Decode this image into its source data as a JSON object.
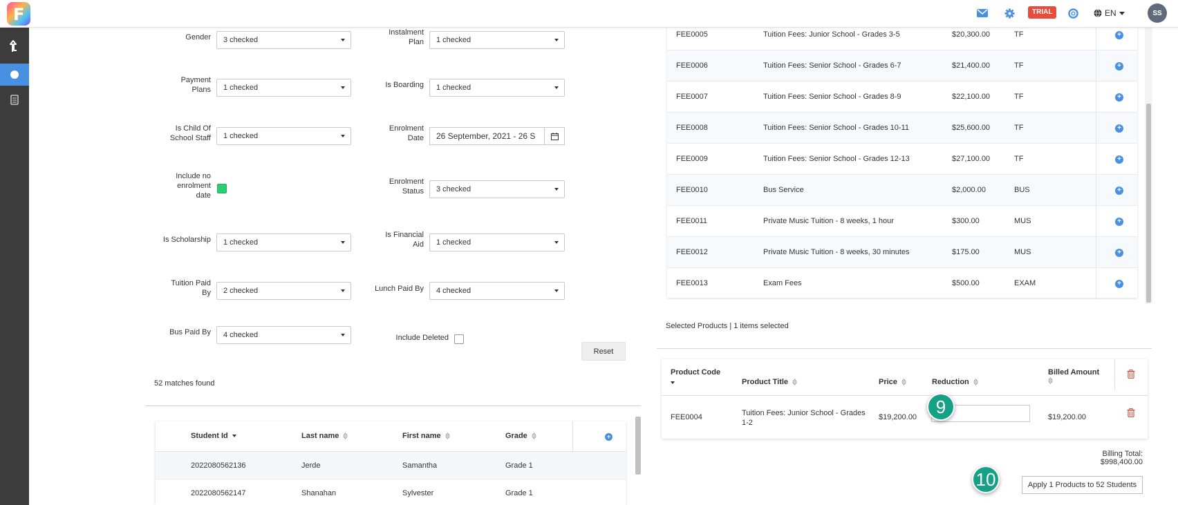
{
  "topbar": {
    "logo_letter": "F",
    "trial_badge": "TRIAL",
    "language": "EN",
    "avatar_initials": "SS",
    "icons": [
      "mail-icon",
      "gear-icon",
      "help-ring-icon",
      "globe-icon"
    ]
  },
  "sidebar": {
    "items": [
      {
        "icon": "upload-arrow-icon",
        "active": false
      },
      {
        "icon": "circle-icon",
        "active": true
      },
      {
        "icon": "document-icon",
        "active": false
      }
    ]
  },
  "filters": {
    "gender": {
      "label": "Gender",
      "value": "3 checked"
    },
    "instalment_plan": {
      "label_line1": "Instalment",
      "label_line2": "Plan",
      "value": "1 checked"
    },
    "payment_plans": {
      "label_line1": "Payment",
      "label_line2": "Plans",
      "value": "1 checked"
    },
    "is_boarding": {
      "label": "Is Boarding",
      "value": "1 checked"
    },
    "is_child_of_staff": {
      "label_line1": "Is Child Of",
      "label_line2": "School Staff",
      "value": "1 checked"
    },
    "enrolment_date": {
      "label_line1": "Enrolment",
      "label_line2": "Date",
      "value": "26 September, 2021 - 26 S"
    },
    "include_no_enrolment_date": {
      "label_line1": "Include no",
      "label_line2": "enrolment",
      "label_line3": "date",
      "checked": true
    },
    "enrolment_status": {
      "label_line1": "Enrolment",
      "label_line2": "Status",
      "value": "3 checked"
    },
    "is_scholarship": {
      "label": "Is Scholarship",
      "value": "1 checked"
    },
    "is_financial_aid": {
      "label_line1": "Is Financial",
      "label_line2": "Aid",
      "value": "1 checked"
    },
    "tuition_paid_by": {
      "label_line1": "Tuition Paid",
      "label_line2": "By",
      "value": "2 checked"
    },
    "lunch_paid_by": {
      "label": "Lunch Paid By",
      "value": "4 checked"
    },
    "bus_paid_by": {
      "label": "Bus Paid By",
      "value": "4 checked"
    },
    "include_deleted": {
      "label": "Include Deleted",
      "checked": false
    },
    "reset_label": "Reset"
  },
  "matches_text": "52 matches found",
  "students": {
    "columns": [
      "Student Id",
      "Last name",
      "First name",
      "Grade"
    ],
    "rows": [
      {
        "id": "2022080562136",
        "last": "Jerde",
        "first": "Samantha",
        "grade": "Grade 1"
      },
      {
        "id": "2022080562147",
        "last": "Shanahan",
        "first": "Sylvester",
        "grade": "Grade 1"
      }
    ]
  },
  "products": {
    "rows": [
      {
        "code": "FEE0005",
        "title": "Tuition Fees: Junior School - Grades 3-5",
        "price": "$20,300.00",
        "type": "TF"
      },
      {
        "code": "FEE0006",
        "title": "Tuition Fees: Senior School - Grades 6-7",
        "price": "$21,400.00",
        "type": "TF"
      },
      {
        "code": "FEE0007",
        "title": "Tuition Fees: Senior School - Grades 8-9",
        "price": "$22,100.00",
        "type": "TF"
      },
      {
        "code": "FEE0008",
        "title": "Tuition Fees: Senior School - Grades 10-11",
        "price": "$25,600.00",
        "type": "TF"
      },
      {
        "code": "FEE0009",
        "title": "Tuition Fees: Senior School - Grades 12-13",
        "price": "$27,100.00",
        "type": "TF"
      },
      {
        "code": "FEE0010",
        "title": "Bus Service",
        "price": "$2,000.00",
        "type": "BUS"
      },
      {
        "code": "FEE0011",
        "title": "Private Music Tuition - 8 weeks, 1 hour",
        "price": "$300.00",
        "type": "MUS"
      },
      {
        "code": "FEE0012",
        "title": "Private Music Tuition - 8 weeks, 30 minutes",
        "price": "$175.00",
        "type": "MUS"
      },
      {
        "code": "FEE0013",
        "title": "Exam Fees",
        "price": "$500.00",
        "type": "EXAM"
      }
    ]
  },
  "selected": {
    "info": "Selected Products | 1 items selected",
    "columns": {
      "code": "Product Code",
      "title": "Product Title",
      "price": "Price",
      "reduction": "Reduction",
      "billed": "Billed Amount"
    },
    "row": {
      "code": "FEE0004",
      "title_line1": "Tuition Fees: Junior School - Grades",
      "title_line2": "1-2",
      "price": "$19,200.00",
      "reduction": "",
      "billed": "$19,200.00"
    },
    "billing_total": "Billing Total: $998,400.00",
    "apply_label": "Apply 1 Products to 52 Students"
  },
  "steps": {
    "step9": "9",
    "step10": "10"
  },
  "colors": {
    "accent": "#4a90e2",
    "trial": "#e74c3c",
    "step": "#16a085",
    "checkbox": "#2ecc71"
  }
}
